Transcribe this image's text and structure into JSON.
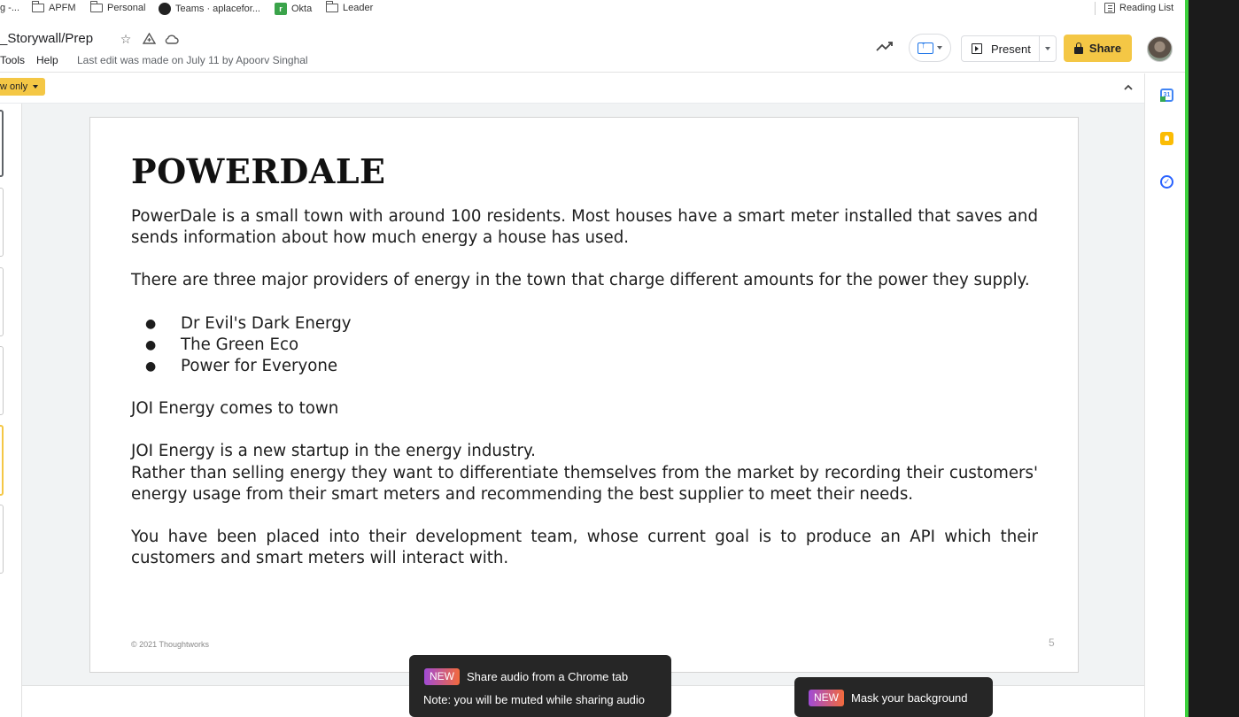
{
  "bookmarks": {
    "items": [
      {
        "label": "g -..."
      },
      {
        "label": "APFM"
      },
      {
        "label": "Personal"
      },
      {
        "label": "Teams · aplacefor..."
      },
      {
        "label": "Okta"
      },
      {
        "label": "Leader"
      }
    ],
    "reading_list": "Reading List"
  },
  "header": {
    "doc_title": "_Storywall/Prep",
    "menu": [
      "Tools",
      "Help"
    ],
    "last_edit": "Last edit was made on July 11 by Apoorv Singhal",
    "present_label": "Present",
    "share_label": "Share"
  },
  "toolbar": {
    "mode_label": "w only"
  },
  "slide": {
    "title": "POWERDALE",
    "p1": "PowerDale is a small town with around 100 residents. Most houses have a smart meter installed that saves and sends information about how much energy a house has used.",
    "p2": "There are three major providers of energy in the town that charge different amounts for the power they supply.",
    "bullets": [
      "Dr Evil's Dark Energy",
      "The Green Eco",
      "Power for Everyone"
    ],
    "p3": "JOI Energy comes to town",
    "p4": "JOI Energy is a new startup in the energy industry.",
    "p5": "Rather than selling energy they want to differentiate themselves from the market by recording their customers' energy usage from their smart meters and recommending the best supplier to meet their needs.",
    "p6": "You have been placed into their development team, whose current goal is to produce an API which their customers and smart meters will interact with.",
    "footer": "© 2021 Thoughtworks",
    "number": "5"
  },
  "toasts": {
    "audio": {
      "badge": "NEW",
      "title": "Share audio from a Chrome tab",
      "note": "Note: you will be muted while sharing audio"
    },
    "mask": {
      "badge": "NEW",
      "title": "Mask your background"
    }
  },
  "sidepanel": {
    "calendar_day": "31"
  },
  "colors": {
    "accent_yellow": "#f4c745",
    "meet_green": "#3cd13c"
  }
}
